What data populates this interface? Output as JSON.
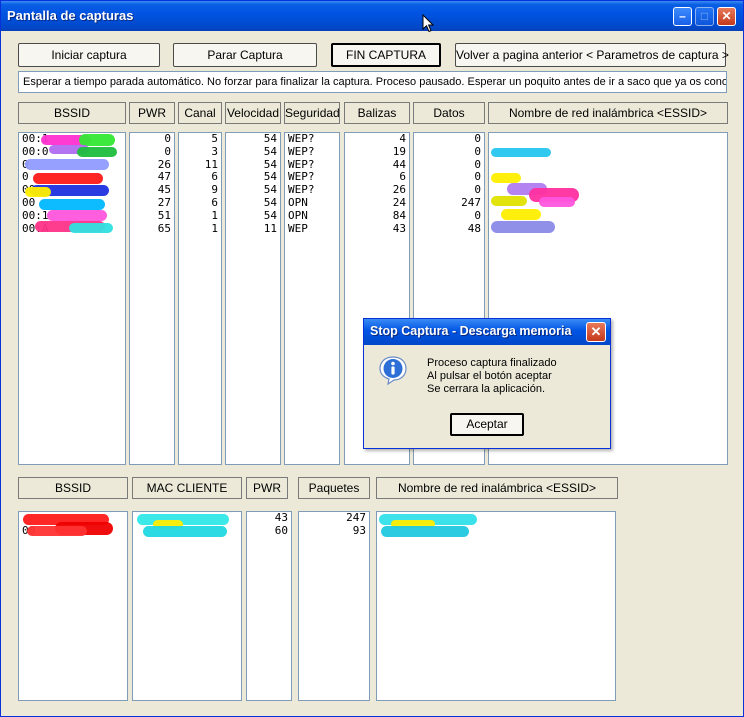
{
  "window": {
    "title": "Pantalla de capturas",
    "controls": {
      "minimize": "–",
      "maximize": "□",
      "close": "✕"
    }
  },
  "toolbar": {
    "iniciar": "Iniciar captura",
    "parar": "Parar Captura",
    "fin": "FIN CAPTURA",
    "volver": "Volver a pagina anterior  < Parametros de captura >"
  },
  "status_text": "Esperar a tiempo parada automático. No forzar para finalizar la captura.  Proceso pausado.  Esperar un poquito antes de ir a saco que ya os conozco",
  "ap_table": {
    "headers": {
      "bssid": "BSSID",
      "pwr": "PWR",
      "canal": "Canal",
      "velocidad": "Velocidad",
      "seguridad": "Seguridad",
      "balizas": "Balizas",
      "datos": "Datos",
      "essid": "Nombre de red inalámbrica  <ESSID>"
    },
    "bssid": [
      "00:1",
      "00:0",
      "0",
      "0",
      "00",
      "00",
      "00:1",
      "00:A"
    ],
    "pwr": [
      "0",
      "0",
      "26",
      "47",
      "45",
      "27",
      "51",
      "65"
    ],
    "canal": [
      "5",
      "3",
      "11",
      "6",
      "9",
      "6",
      "1",
      "1"
    ],
    "velocidad": [
      "54",
      "54",
      "54",
      "54",
      "54",
      "54",
      "54",
      "11"
    ],
    "seguridad": [
      "WEP?",
      "WEP?",
      "WEP?",
      "WEP?",
      "WEP?",
      "OPN",
      "OPN",
      "WEP"
    ],
    "balizas": [
      "4",
      "19",
      "44",
      "6",
      "26",
      "24",
      "84",
      "43"
    ],
    "datos": [
      "0",
      "0",
      "0",
      "0",
      "0",
      "247",
      "0",
      "48"
    ],
    "essid": [
      "",
      "",
      "",
      "",
      "",
      "",
      "",
      ""
    ]
  },
  "client_table": {
    "headers": {
      "bssid": "BSSID",
      "mac": "MAC CLIENTE",
      "pwr": "PWR",
      "paquetes": "Paquetes",
      "essid": "Nombre de red inalámbrica  <ESSID>"
    },
    "bssid": [
      "",
      "00"
    ],
    "mac": [
      "",
      ""
    ],
    "pwr": [
      "43",
      "60"
    ],
    "paquetes": [
      "247",
      "93"
    ],
    "essid": [
      "",
      ""
    ]
  },
  "dialog": {
    "title": "Stop Captura - Descarga memoria",
    "close": "✕",
    "line1": "Proceso captura finalizado",
    "line2": "Al pulsar el botón aceptar",
    "line3": "Se cerrara la aplicación.",
    "accept": "Aceptar",
    "icon": "info-icon"
  },
  "colors": {
    "titlebar": "#0054e3",
    "face": "#ece9d8",
    "close": "#c4391a"
  }
}
